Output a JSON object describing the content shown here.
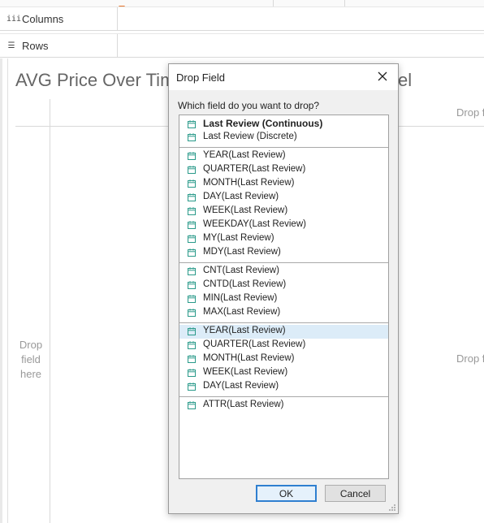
{
  "shelves": {
    "columns_label": "Columns",
    "columns_icon": "iii",
    "rows_label": "Rows",
    "rows_icon": "☰"
  },
  "view": {
    "title_visible": "AVG Price Over Tim",
    "title_tail": "el",
    "drop_field_left_line1": "Drop",
    "drop_field_left_line2": "field",
    "drop_field_left_line3": "here",
    "drop_right_top": "Drop f",
    "drop_right_mid": "Drop f"
  },
  "dialog": {
    "title": "Drop Field",
    "question": "Which field do you want to drop?",
    "ok_label": "OK",
    "cancel_label": "Cancel",
    "groups": [
      {
        "items": [
          "Last Review (Continuous)",
          "Last Review (Discrete)"
        ]
      },
      {
        "items": [
          "YEAR(Last Review)",
          "QUARTER(Last Review)",
          "MONTH(Last Review)",
          "DAY(Last Review)",
          "WEEK(Last Review)",
          "WEEKDAY(Last Review)",
          "MY(Last Review)",
          "MDY(Last Review)"
        ]
      },
      {
        "items": [
          "CNT(Last Review)",
          "CNTD(Last Review)",
          "MIN(Last Review)",
          "MAX(Last Review)"
        ]
      },
      {
        "items": [
          "YEAR(Last Review)",
          "QUARTER(Last Review)",
          "MONTH(Last Review)",
          "WEEK(Last Review)",
          "DAY(Last Review)"
        ]
      },
      {
        "items": [
          "ATTR(Last Review)"
        ]
      }
    ],
    "selected_item": "YEAR(Last Review)",
    "icon": "calendar-icon"
  },
  "colors": {
    "accent_marker": "#e8762d",
    "calendar_icon": "#2a9a8a",
    "selection": "#dcecf8",
    "ok_border": "#2f7fd0"
  }
}
